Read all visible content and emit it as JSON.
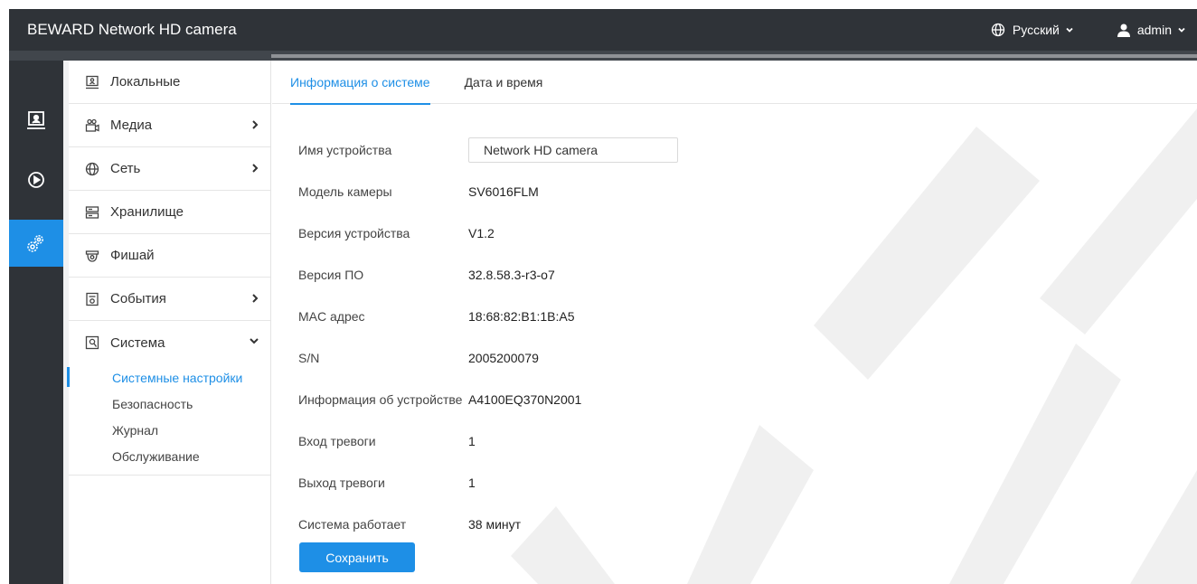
{
  "app": {
    "title": "BEWARD Network HD camera",
    "language": "Русский",
    "user": "admin"
  },
  "rail": [
    {
      "icon": "live-view-icon"
    },
    {
      "icon": "playback-icon"
    },
    {
      "icon": "settings-icon",
      "active": true
    }
  ],
  "menu": {
    "items": [
      {
        "label": "Локальные",
        "icon": "local-icon"
      },
      {
        "label": "Медиа",
        "icon": "media-icon",
        "arrow": "right"
      },
      {
        "label": "Сеть",
        "icon": "globe-icon",
        "arrow": "right"
      },
      {
        "label": "Хранилище",
        "icon": "storage-icon"
      },
      {
        "label": "Фишай",
        "icon": "fisheye-icon"
      },
      {
        "label": "События",
        "icon": "events-icon",
        "arrow": "right"
      },
      {
        "label": "Система",
        "icon": "system-icon",
        "arrow": "down"
      }
    ],
    "system_sub": [
      {
        "label": "Системные настройки",
        "active": true
      },
      {
        "label": "Безопасность"
      },
      {
        "label": "Журнал"
      },
      {
        "label": "Обслуживание"
      }
    ]
  },
  "tabs": [
    {
      "label": "Информация о системе",
      "active": true
    },
    {
      "label": "Дата и время"
    }
  ],
  "form": {
    "device_name_label": "Имя устройства",
    "device_name_value": "Network HD camera",
    "rows": [
      {
        "label": "Модель камеры",
        "value": "SV6016FLM"
      },
      {
        "label": "Версия устройства",
        "value": "V1.2"
      },
      {
        "label": "Версия ПО",
        "value": "32.8.58.3-r3-o7"
      },
      {
        "label": "MAC адрес",
        "value": "18:68:82:B1:1B:A5"
      },
      {
        "label": "S/N",
        "value": "2005200079"
      },
      {
        "label": "Информация об устройстве",
        "value": "A4100EQ370N2001"
      },
      {
        "label": "Вход тревоги",
        "value": "1"
      },
      {
        "label": "Выход тревоги",
        "value": "1"
      },
      {
        "label": "Система работает",
        "value": "38 минут"
      }
    ],
    "save_label": "Сохранить"
  },
  "colors": {
    "accent": "#1e8fe6",
    "topbar": "#2f3338",
    "watermark": "#eeeeee"
  }
}
